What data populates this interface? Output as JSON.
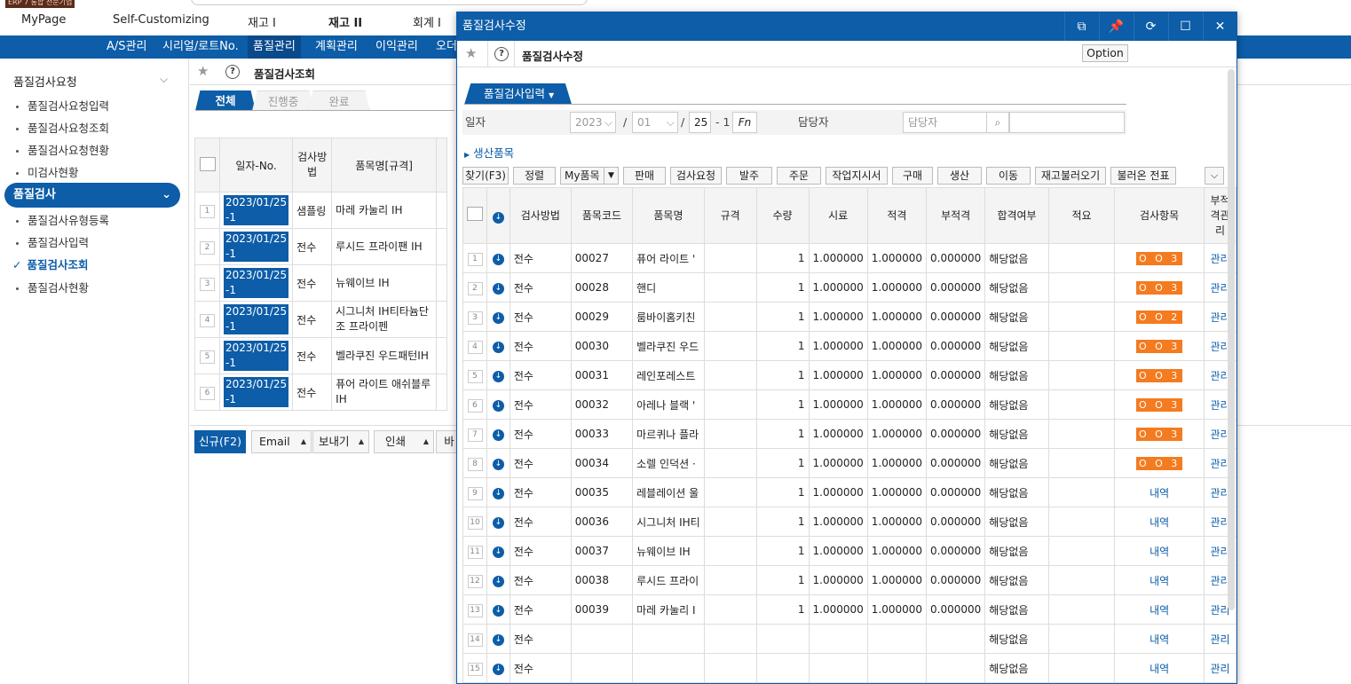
{
  "app": {
    "logo_text": "ERP 7 통합 전문기업"
  },
  "top_menu": [
    {
      "label": "MyPage"
    },
    {
      "label": "Self-Customizing"
    },
    {
      "label": "재고 I"
    },
    {
      "label": "재고 II"
    },
    {
      "label": "회계 I"
    }
  ],
  "sub_nav": [
    {
      "label": "A/S관리"
    },
    {
      "label": "시리얼/로트No."
    },
    {
      "label": "품질관리"
    },
    {
      "label": "계획관리"
    },
    {
      "label": "이익관리"
    },
    {
      "label": "오더"
    }
  ],
  "sidebar": {
    "group1": "품질검사요청",
    "group1_items": [
      "품질검사요청입력",
      "품질검사요청조회",
      "품질검사요청현황",
      "미검사현황"
    ],
    "group2": "품질검사",
    "group2_items": [
      "품질검사유형등록",
      "품질검사입력",
      "품질검사조회",
      "품질검사현황"
    ]
  },
  "main": {
    "page_title": "품질검사조회",
    "tabs": [
      "전체",
      "진행중",
      "완료"
    ],
    "columns": [
      "일자-No.",
      "검사방법",
      "품목명[규격]"
    ],
    "rows": [
      {
        "no": "1",
        "date": "2023/01/25",
        "seq": "-1",
        "method": "샘플링",
        "item": "마레 카눌리 IH"
      },
      {
        "no": "2",
        "date": "2023/01/25",
        "seq": "-1",
        "method": "전수",
        "item": "루시드 프라이팬 IH"
      },
      {
        "no": "3",
        "date": "2023/01/25",
        "seq": "-1",
        "method": "전수",
        "item": "뉴웨이브 IH"
      },
      {
        "no": "4",
        "date": "2023/01/25",
        "seq": "-1",
        "method": "전수",
        "item": "시그니처 IH티타늄단조 프라이펜"
      },
      {
        "no": "5",
        "date": "2023/01/25",
        "seq": "-1",
        "method": "전수",
        "item": "벨라쿠진 우드패턴IH"
      },
      {
        "no": "6",
        "date": "2023/01/25",
        "seq": "-1",
        "method": "전수",
        "item": "퓨어 라이트 애쉬블루 IH"
      }
    ],
    "bottom_buttons": {
      "new": "신규(F2)",
      "email": "Email",
      "export": "보내기",
      "print": "인쇄",
      "more": "바"
    }
  },
  "modal": {
    "title": "품질검사수정",
    "page_title": "품질검사수정",
    "option": "Option",
    "form_tab": "품질검사입력",
    "date_label": "일자",
    "year": "2023",
    "month": "01",
    "day": "25",
    "seq": "- 1",
    "fn": "Fn",
    "manager_label": "담당자",
    "manager_placeholder": "담당자",
    "sub_toggle": "생산품목",
    "buttons": [
      "찾기(F3)",
      "정렬",
      "My품목",
      "판매",
      "검사요청",
      "발주",
      "주문",
      "작업지시서",
      "구매",
      "생산",
      "이동",
      "재고불러오기",
      "불러온 전표"
    ],
    "columns": [
      "검사방법",
      "품목코드",
      "품목명",
      "규격",
      "수량",
      "시료",
      "적격",
      "부적격",
      "합격여부",
      "적요",
      "검사항목",
      "부적격관리"
    ],
    "rows": [
      {
        "no": "1",
        "method": "전수",
        "code": "00027",
        "name": "퓨어 라이트 '",
        "qty": "1",
        "sample": "1.000000",
        "pass": "1.000000",
        "fail": "0.000000",
        "result": "해당없음",
        "check": "O O 3",
        "check_type": "badge",
        "manage": "관리"
      },
      {
        "no": "2",
        "method": "전수",
        "code": "00028",
        "name": "핸디",
        "qty": "1",
        "sample": "1.000000",
        "pass": "1.000000",
        "fail": "0.000000",
        "result": "해당없음",
        "check": "O O 3",
        "check_type": "badge",
        "manage": "관리"
      },
      {
        "no": "3",
        "method": "전수",
        "code": "00029",
        "name": "룸바이홈키친",
        "qty": "1",
        "sample": "1.000000",
        "pass": "1.000000",
        "fail": "0.000000",
        "result": "해당없음",
        "check": "O O 2",
        "check_type": "badge",
        "manage": "관리"
      },
      {
        "no": "4",
        "method": "전수",
        "code": "00030",
        "name": "벨라쿠진 우드",
        "qty": "1",
        "sample": "1.000000",
        "pass": "1.000000",
        "fail": "0.000000",
        "result": "해당없음",
        "check": "O O 3",
        "check_type": "badge",
        "manage": "관리"
      },
      {
        "no": "5",
        "method": "전수",
        "code": "00031",
        "name": "레인포레스트",
        "qty": "1",
        "sample": "1.000000",
        "pass": "1.000000",
        "fail": "0.000000",
        "result": "해당없음",
        "check": "O O 3",
        "check_type": "badge",
        "manage": "관리"
      },
      {
        "no": "6",
        "method": "전수",
        "code": "00032",
        "name": "아레나 블랙 '",
        "qty": "1",
        "sample": "1.000000",
        "pass": "1.000000",
        "fail": "0.000000",
        "result": "해당없음",
        "check": "O O 3",
        "check_type": "badge",
        "manage": "관리"
      },
      {
        "no": "7",
        "method": "전수",
        "code": "00033",
        "name": "마르퀴나 플라",
        "qty": "1",
        "sample": "1.000000",
        "pass": "1.000000",
        "fail": "0.000000",
        "result": "해당없음",
        "check": "O O 3",
        "check_type": "badge",
        "manage": "관리"
      },
      {
        "no": "8",
        "method": "전수",
        "code": "00034",
        "name": "소렐 인덕션 ·",
        "qty": "1",
        "sample": "1.000000",
        "pass": "1.000000",
        "fail": "0.000000",
        "result": "해당없음",
        "check": "O O 3",
        "check_type": "badge",
        "manage": "관리"
      },
      {
        "no": "9",
        "method": "전수",
        "code": "00035",
        "name": "레블레이션 울",
        "qty": "1",
        "sample": "1.000000",
        "pass": "1.000000",
        "fail": "0.000000",
        "result": "해당없음",
        "check": "내역",
        "check_type": "link",
        "manage": "관리"
      },
      {
        "no": "10",
        "method": "전수",
        "code": "00036",
        "name": "시그니처 IH티",
        "qty": "1",
        "sample": "1.000000",
        "pass": "1.000000",
        "fail": "0.000000",
        "result": "해당없음",
        "check": "내역",
        "check_type": "link",
        "manage": "관리"
      },
      {
        "no": "11",
        "method": "전수",
        "code": "00037",
        "name": "뉴웨이브 IH",
        "qty": "1",
        "sample": "1.000000",
        "pass": "1.000000",
        "fail": "0.000000",
        "result": "해당없음",
        "check": "내역",
        "check_type": "link",
        "manage": "관리"
      },
      {
        "no": "12",
        "method": "전수",
        "code": "00038",
        "name": "루시드 프라이",
        "qty": "1",
        "sample": "1.000000",
        "pass": "1.000000",
        "fail": "0.000000",
        "result": "해당없음",
        "check": "내역",
        "check_type": "link",
        "manage": "관리"
      },
      {
        "no": "13",
        "method": "전수",
        "code": "00039",
        "name": "마레 카눌리 I",
        "qty": "1",
        "sample": "1.000000",
        "pass": "1.000000",
        "fail": "0.000000",
        "result": "해당없음",
        "check": "내역",
        "check_type": "link",
        "manage": "관리"
      },
      {
        "no": "14",
        "method": "전수",
        "code": "",
        "name": "",
        "qty": "",
        "sample": "",
        "pass": "",
        "fail": "",
        "result": "해당없음",
        "check": "내역",
        "check_type": "link",
        "manage": "관리"
      },
      {
        "no": "15",
        "method": "전수",
        "code": "",
        "name": "",
        "qty": "",
        "sample": "",
        "pass": "",
        "fail": "",
        "result": "해당없음",
        "check": "내역",
        "check_type": "link",
        "manage": "관리"
      }
    ]
  },
  "colors": {
    "primary": "#0d5da8",
    "badge": "#f47b20"
  }
}
